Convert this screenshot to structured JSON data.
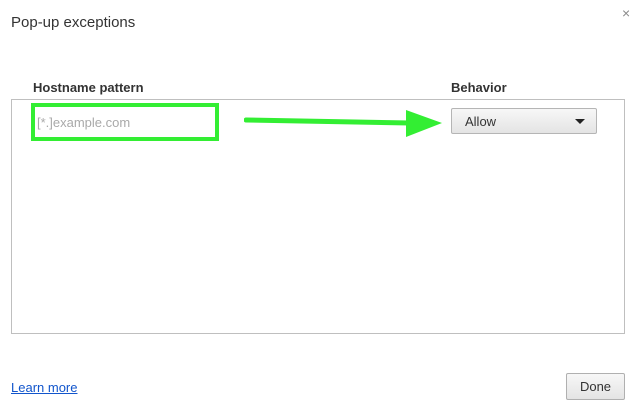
{
  "dialog": {
    "title": "Pop-up exceptions",
    "close_icon": "close-icon",
    "close_glyph": "×"
  },
  "columns": {
    "hostname_header": "Hostname pattern",
    "behavior_header": "Behavior"
  },
  "hostname_input": {
    "value": "",
    "placeholder": "[*.]example.com"
  },
  "behavior_select": {
    "selected": "Allow",
    "caret_icon": "dropdown-arrow-icon"
  },
  "annotation": {
    "highlight_color": "#33ee33",
    "arrow_icon": "right-arrow-icon"
  },
  "footer": {
    "learn_more": "Learn more",
    "done_label": "Done"
  },
  "colors": {
    "link": "#1155cc",
    "annotation": "#33ee33"
  }
}
